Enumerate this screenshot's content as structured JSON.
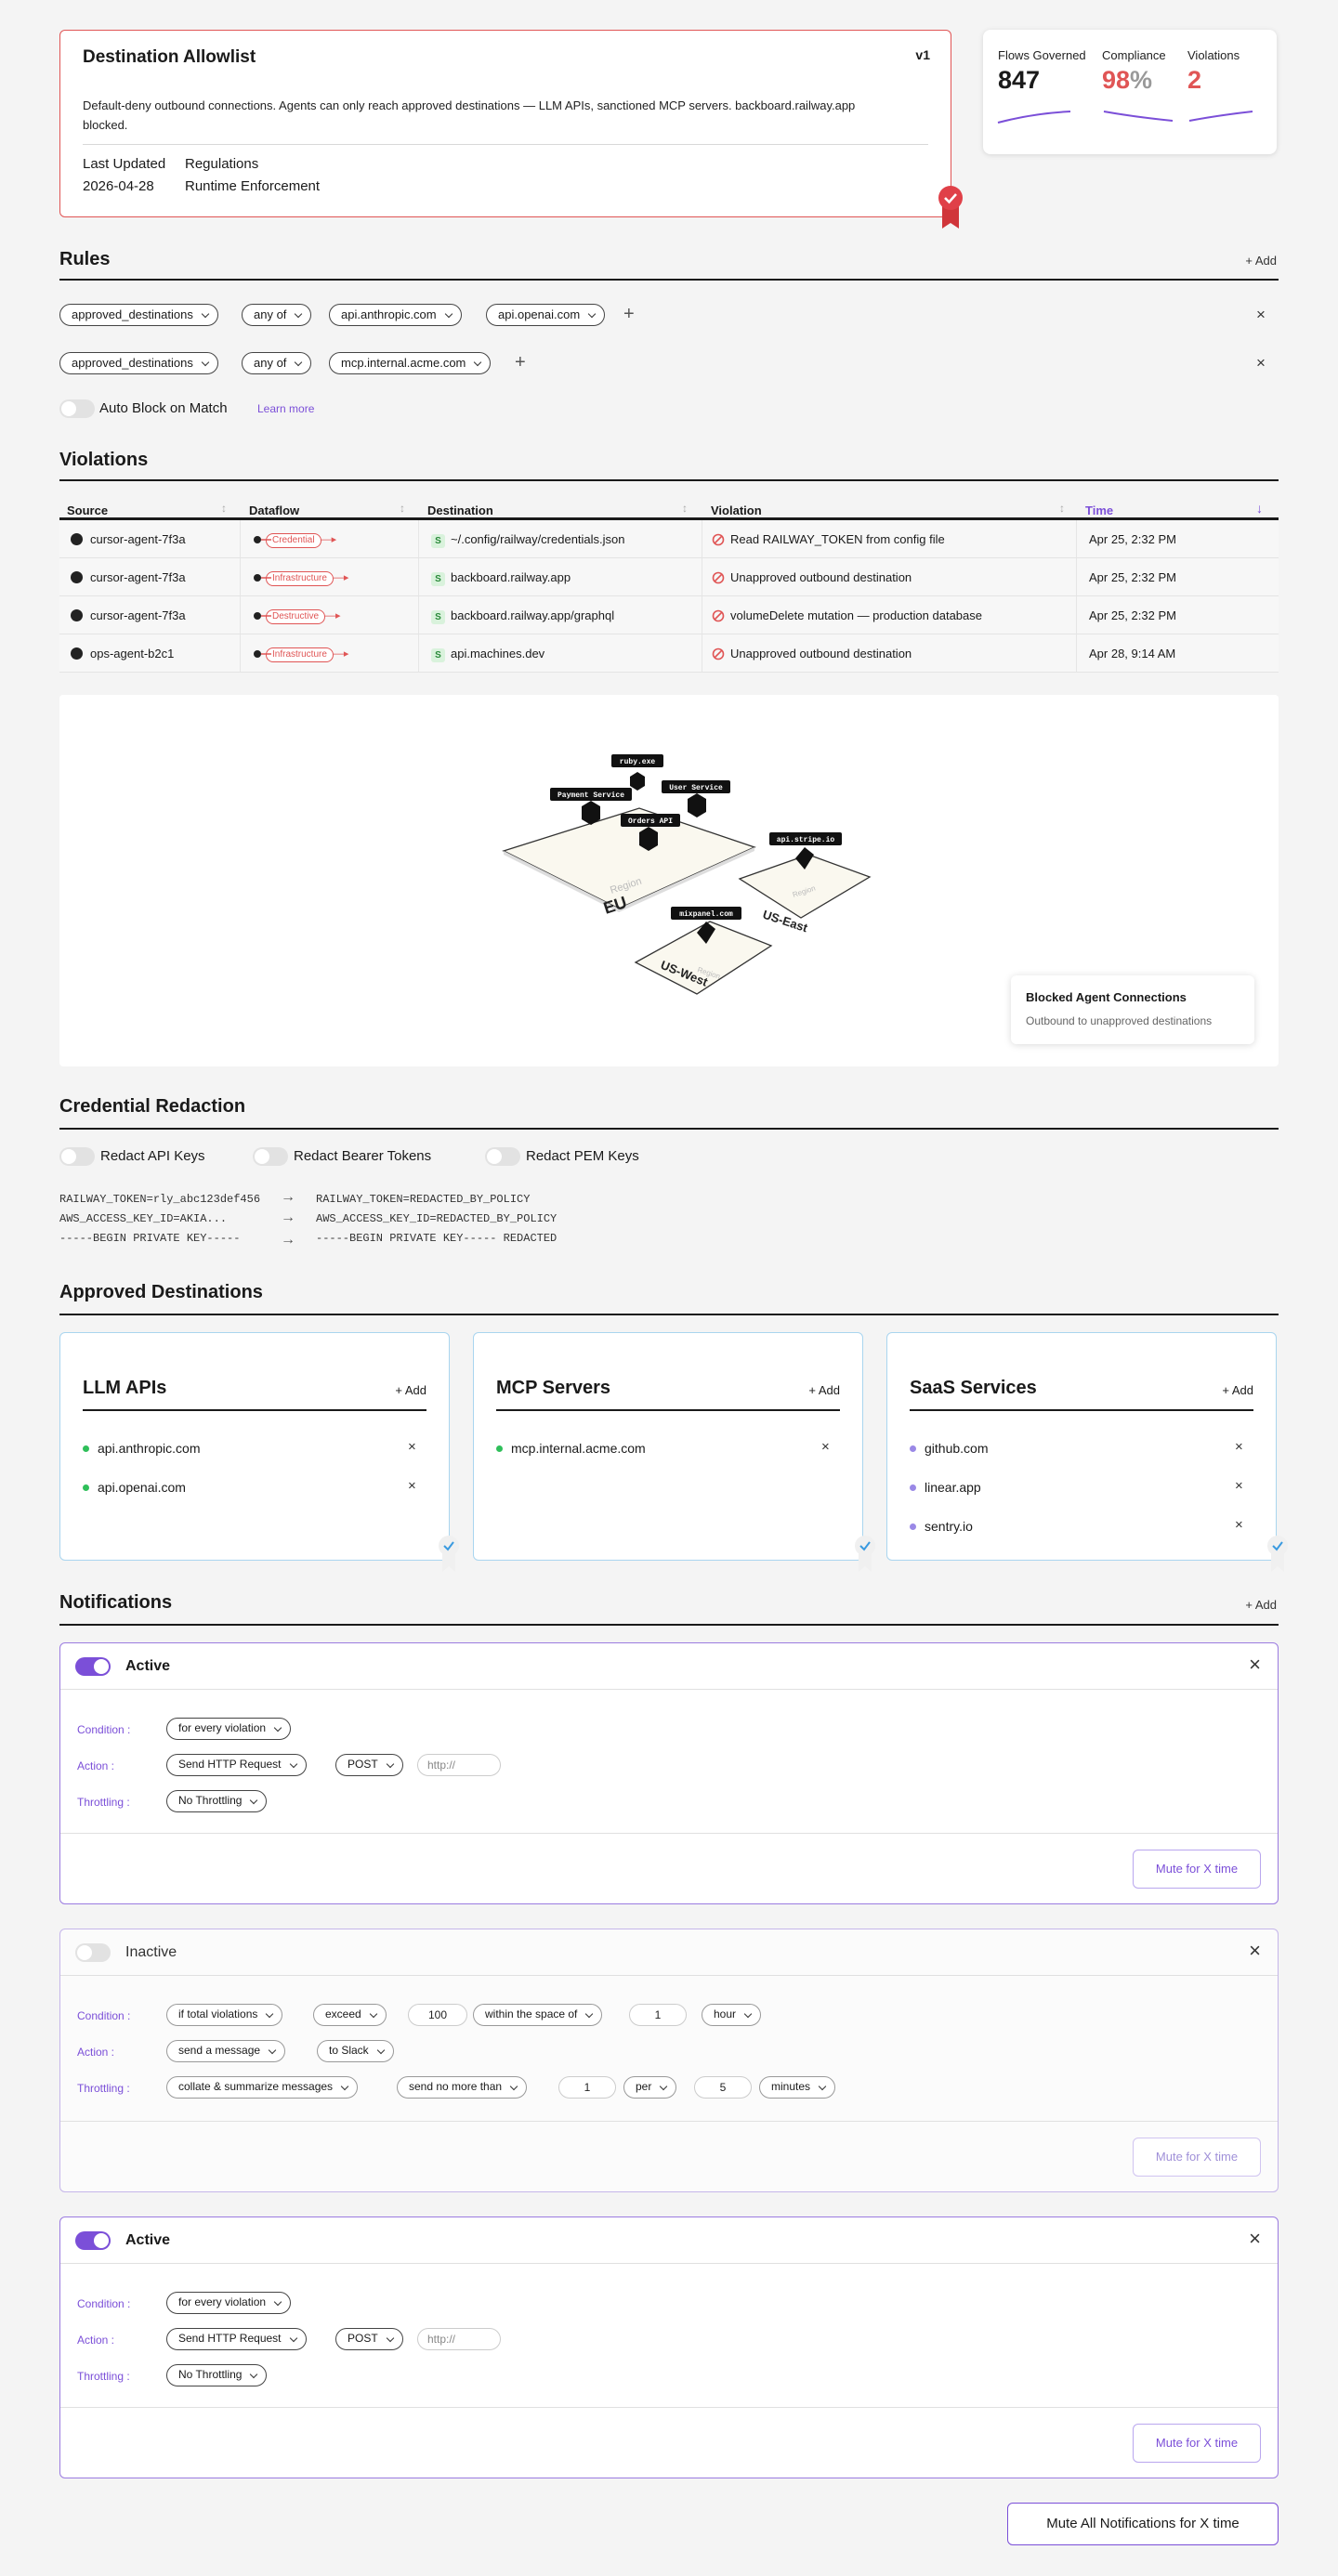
{
  "policy": {
    "title": "Destination Allowlist",
    "version": "v1",
    "description": "Default-deny outbound connections. Agents can only reach approved destinations — LLM APIs, sanctioned MCP servers. backboard.railway.app blocked.",
    "last_updated_label": "Last Updated",
    "last_updated": "2026-04-28",
    "regulations_label": "Regulations",
    "regulations": "Runtime Enforcement"
  },
  "stats": {
    "flows_label": "Flows Governed",
    "flows_value": "847",
    "compliance_label": "Compliance",
    "compliance_value": "98",
    "compliance_unit": "%",
    "violations_label": "Violations",
    "violations_value": "2"
  },
  "rules": {
    "title": "Rules",
    "add_label": "Add",
    "rule1": {
      "field": "approved_destinations",
      "op": "any of",
      "v1": "api.anthropic.com",
      "v2": "api.openai.com"
    },
    "rule2": {
      "field": "approved_destinations",
      "op": "any of",
      "v1": "mcp.internal.acme.com"
    },
    "auto_block_label": "Auto Block on Match",
    "learn_more": "Learn more"
  },
  "violations": {
    "title": "Violations",
    "columns": {
      "source": "Source",
      "dataflow": "Dataflow",
      "destination": "Destination",
      "violation": "Violation",
      "time": "Time"
    },
    "rows": [
      {
        "source": "cursor-agent-7f3a",
        "tag": "Credential",
        "destination": "~/.config/railway/credentials.json",
        "violation": "Read RAILWAY_TOKEN from config file",
        "time": "Apr 25, 2:32 PM"
      },
      {
        "source": "cursor-agent-7f3a",
        "tag": "Infrastructure",
        "destination": "backboard.railway.app",
        "violation": "Unapproved outbound destination",
        "time": "Apr 25, 2:32 PM"
      },
      {
        "source": "cursor-agent-7f3a",
        "tag": "Destructive",
        "destination": "backboard.railway.app/graphql",
        "violation": "volumeDelete mutation — production database",
        "time": "Apr 25, 2:32 PM"
      },
      {
        "source": "ops-agent-b2c1",
        "tag": "Infrastructure",
        "destination": "api.machines.dev",
        "violation": "Unapproved outbound destination",
        "time": "Apr 28, 9:14 AM"
      }
    ]
  },
  "map": {
    "regions": {
      "eu": "EU",
      "us_east": "US-East",
      "us_west": "US-West",
      "region_word": "Region"
    },
    "nodes": {
      "ruby": "ruby.exe",
      "payment": "Payment Service",
      "user": "User Service",
      "orders": "Orders API",
      "stripe": "api.stripe.io",
      "mixpanel": "mixpanel.com"
    },
    "tooltip_title": "Blocked Agent Connections",
    "tooltip_sub": "Outbound to unapproved destinations"
  },
  "redaction": {
    "title": "Credential Redaction",
    "toggles": [
      "Redact API Keys",
      "Redact Bearer Tokens",
      "Redact PEM Keys"
    ],
    "lines": [
      {
        "before": "RAILWAY_TOKEN=rly_abc123def456",
        "after": "RAILWAY_TOKEN=REDACTED_BY_POLICY"
      },
      {
        "before": "AWS_ACCESS_KEY_ID=AKIA...",
        "after": "AWS_ACCESS_KEY_ID=REDACTED_BY_POLICY"
      },
      {
        "before": "-----BEGIN PRIVATE KEY-----",
        "after": "-----BEGIN PRIVATE KEY----- REDACTED"
      }
    ]
  },
  "destinations": {
    "title": "Approved Destinations",
    "add_label": "Add",
    "cards": [
      {
        "title": "LLM APIs",
        "items": [
          "api.anthropic.com",
          "api.openai.com"
        ]
      },
      {
        "title": "MCP Servers",
        "items": [
          "mcp.internal.acme.com"
        ]
      },
      {
        "title": "SaaS Services",
        "items": [
          "github.com",
          "linear.app",
          "sentry.io"
        ]
      }
    ]
  },
  "notifications": {
    "title": "Notifications",
    "add_label": "Add",
    "condition_label": "Condition :",
    "action_label": "Action :",
    "throttling_label": "Throttling :",
    "mute_label": "Mute for X time",
    "n1": {
      "state": "Active",
      "condition": "for every violation",
      "action": "Send HTTP Request",
      "method": "POST",
      "url_placeholder": "http://",
      "throttling": "No Throttling"
    },
    "n2": {
      "state": "Inactive",
      "condition": "if total violations",
      "cmp": "exceed",
      "count": "100",
      "window": "within the space of",
      "window_n": "1",
      "unit": "hour",
      "action": "send a message",
      "target": "to Slack",
      "throttling": "collate & summarize messages",
      "limit": "send no more than",
      "limit_n": "1",
      "per": "per",
      "per_n": "5",
      "per_unit": "minutes"
    },
    "n3": {
      "state": "Active",
      "condition": "for every violation",
      "action": "Send HTTP Request",
      "method": "POST",
      "url_placeholder": "http://",
      "throttling": "No Throttling"
    },
    "mute_all": "Mute All Notifications for X time"
  },
  "colors": {
    "accent": "#7b4fd8",
    "danger": "#e05555",
    "ok": "#2fbf5a",
    "saas": "#9a88e6"
  }
}
